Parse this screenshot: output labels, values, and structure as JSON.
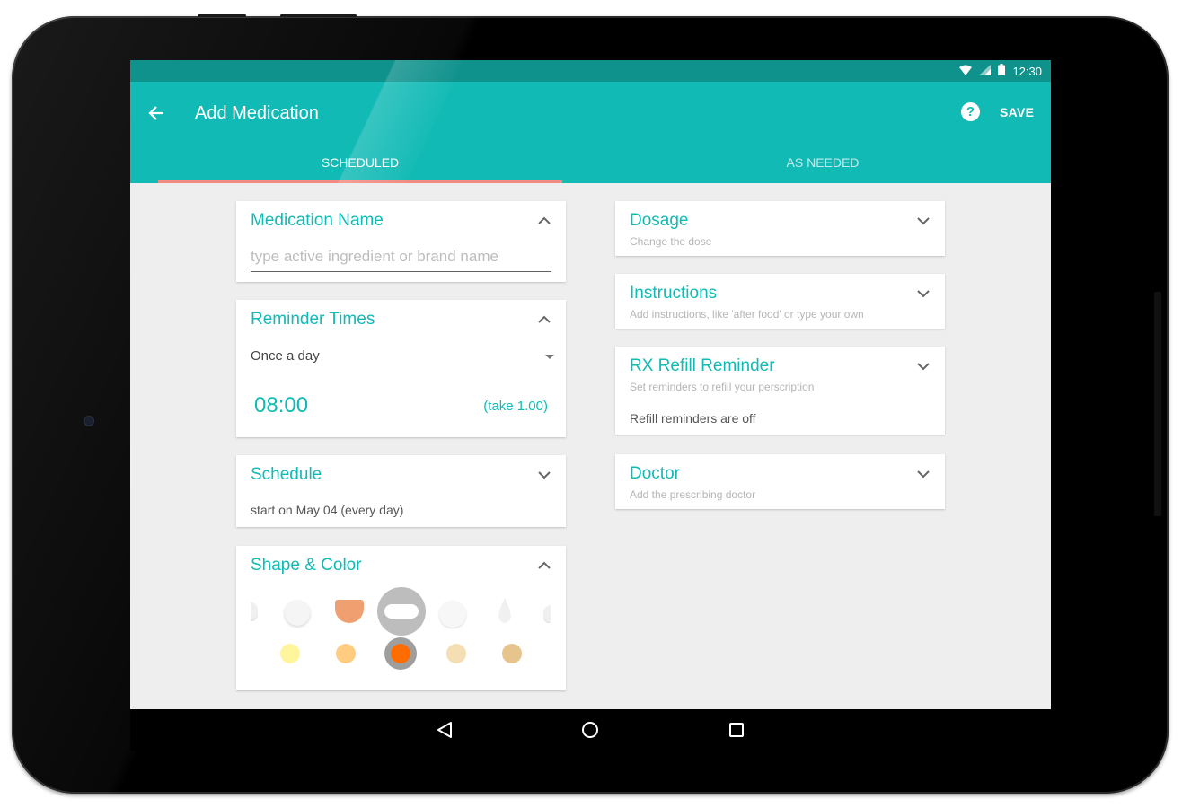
{
  "statusbar": {
    "time": "12:30",
    "icons": [
      "wifi-icon",
      "signal-icon",
      "battery-icon"
    ]
  },
  "appbar": {
    "title": "Add Medication",
    "back_icon": "arrow-left-icon",
    "help_icon": "help-icon",
    "help_glyph": "?",
    "save_label": "SAVE",
    "accent_color": "#12bab5",
    "statusbar_color": "#0f918c"
  },
  "tabs": [
    {
      "label": "SCHEDULED",
      "selected": true
    },
    {
      "label": "AS NEEDED",
      "selected": false
    }
  ],
  "cards": {
    "medication_name": {
      "title": "Medication Name",
      "placeholder": "type active ingredient or brand name",
      "value": "",
      "expanded": true
    },
    "reminder_times": {
      "title": "Reminder Times",
      "frequency": "Once a day",
      "time": "08:00",
      "dose": "(take 1.00)",
      "expanded": true
    },
    "schedule": {
      "title": "Schedule",
      "summary": "start on May 04 (every day)",
      "expanded": false
    },
    "shape_color": {
      "title": "Shape & Color",
      "expanded": true,
      "shapes": [
        "half-round",
        "round",
        "shield",
        "capsule",
        "round-large",
        "drop",
        "half-round-right"
      ],
      "selected_shape": "capsule",
      "colors": [
        "#fff59d",
        "#ffcc80",
        "#ff6d00",
        "#f5deb3",
        "#e6c48c"
      ],
      "selected_color": "#ff6d00"
    },
    "dosage": {
      "title": "Dosage",
      "subtitle": "Change the dose",
      "expanded": false
    },
    "instructions": {
      "title": "Instructions",
      "subtitle": "Add instructions, like 'after food' or type your own",
      "expanded": false
    },
    "refill": {
      "title": "RX Refill Reminder",
      "subtitle": "Set reminders to refill your perscription",
      "status": "Refill reminders are off",
      "expanded": false
    },
    "doctor": {
      "title": "Doctor",
      "subtitle": "Add the prescribing doctor",
      "expanded": false
    }
  },
  "navbar": {
    "buttons": [
      "back-nav-icon",
      "home-nav-icon",
      "recents-nav-icon"
    ]
  }
}
